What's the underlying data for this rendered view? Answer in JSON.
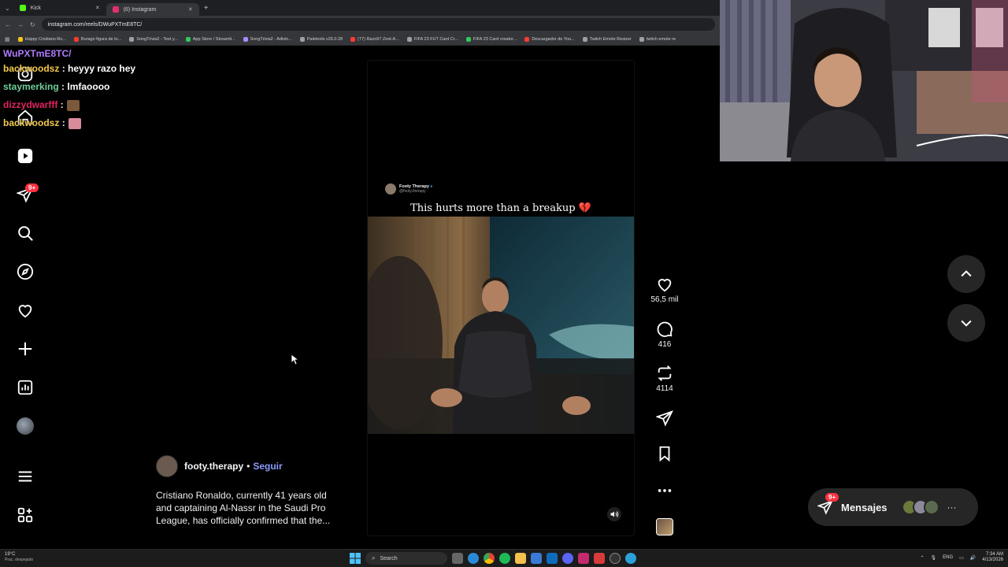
{
  "browser": {
    "tabs": [
      {
        "label": "Kick",
        "active": false,
        "favicon_color": "#53fc18"
      },
      {
        "label": "(6) Instagram",
        "active": true,
        "favicon_color": "#e1306c"
      }
    ],
    "url": "instagram.com/reels/DWuPXTmE8TC/",
    "bookmarks": [
      {
        "label": "Happy Cristiano Ro...",
        "color": "#f5c518"
      },
      {
        "label": "Burago figura de to...",
        "color": "#ff3b30"
      },
      {
        "label": "SongTrivia2 - Test y...",
        "color": "#9aa0a6"
      },
      {
        "label": "App Store / Streamli...",
        "color": "#34c759"
      },
      {
        "label": "SongTrivia2 - Adivin...",
        "color": "#a78bfa"
      },
      {
        "label": "Paletools v26.0.28",
        "color": "#9aa0a6"
      },
      {
        "label": "(77) Razo97 Zest-A...",
        "color": "#ff3b30"
      },
      {
        "label": "FIFA 23 FUT Card Cr...",
        "color": "#9aa0a6"
      },
      {
        "label": "FIFA 23 Card creator...",
        "color": "#34c759"
      },
      {
        "label": "Descargador de You...",
        "color": "#ff3b30"
      },
      {
        "label": "Twitch Emote Resizer",
        "color": "#9aa0a6"
      },
      {
        "label": "twitch emote re",
        "color": "#9aa0a6"
      }
    ]
  },
  "chat": {
    "header": "WuPXTmE8TC/",
    "messages": [
      {
        "user": "backwoodsz",
        "text": "heyyy razo hey",
        "color": "#f2c94c",
        "emote": null
      },
      {
        "user": "staymerking",
        "text": "lmfaoooo",
        "color": "#6fcf97",
        "emote": null
      },
      {
        "user": "dizzydwarfff",
        "text": "",
        "color": "#e0245e",
        "emote": "#7a5a3a"
      },
      {
        "user": "backwoodsz",
        "text": "",
        "color": "#f2c94c",
        "emote": "#d98b9b"
      }
    ]
  },
  "sidebar": {
    "notification_badge": "9+"
  },
  "reel": {
    "source_name": "Footy Therapy",
    "source_handle": "@footy.therapy",
    "overlay_caption": "This hurts more than a breakup 💔",
    "likes": "56,5 mil",
    "comments": "416",
    "reposts": "4114"
  },
  "post": {
    "author": "footy.therapy",
    "separator": "•",
    "follow_label": "Seguir",
    "caption": "Cristiano Ronaldo, currently 41 years old and captaining Al-Nassr in the Saudi Pro League, has officially confirmed that the..."
  },
  "messages": {
    "label": "Mensajes",
    "badge": "9+"
  },
  "taskbar": {
    "weather_temp": "19°C",
    "weather_desc": "Prac. despejado",
    "search_label": "Search",
    "lang": "ENG",
    "time": "7:34 AM",
    "date": "4/13/2026"
  },
  "colors": {
    "accent_follow": "#8e9cff",
    "badge_red": "#ff3040",
    "bg": "#000000"
  }
}
